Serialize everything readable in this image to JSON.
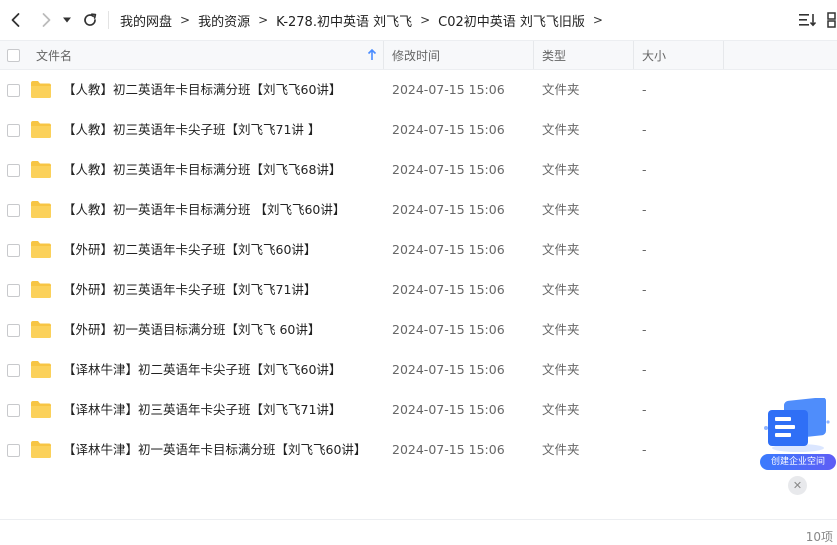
{
  "breadcrumb": [
    "我的网盘",
    "我的资源",
    "K-278.初中英语 刘飞飞",
    "C02初中英语 刘飞飞旧版"
  ],
  "breadcrumb_separator": ">",
  "table": {
    "columns": {
      "name": "文件名",
      "modified": "修改时间",
      "type": "类型",
      "size": "大小"
    },
    "rows": [
      {
        "name": "【人教】初二英语年卡目标满分班【刘飞飞60讲】",
        "modified": "2024-07-15 15:06",
        "type": "文件夹",
        "size": "-"
      },
      {
        "name": "【人教】初三英语年卡尖子班【刘飞飞71讲 】",
        "modified": "2024-07-15 15:06",
        "type": "文件夹",
        "size": "-"
      },
      {
        "name": "【人教】初三英语年卡目标满分班【刘飞飞68讲】",
        "modified": "2024-07-15 15:06",
        "type": "文件夹",
        "size": "-"
      },
      {
        "name": "【人教】初一英语年卡目标满分班 【刘飞飞60讲】",
        "modified": "2024-07-15 15:06",
        "type": "文件夹",
        "size": "-"
      },
      {
        "name": "【外研】初二英语年卡尖子班【刘飞飞60讲】",
        "modified": "2024-07-15 15:06",
        "type": "文件夹",
        "size": "-"
      },
      {
        "name": "【外研】初三英语年卡尖子班【刘飞飞71讲】",
        "modified": "2024-07-15 15:06",
        "type": "文件夹",
        "size": "-"
      },
      {
        "name": "【外研】初一英语目标满分班【刘飞飞 60讲】",
        "modified": "2024-07-15 15:06",
        "type": "文件夹",
        "size": "-"
      },
      {
        "name": "【译林牛津】初二英语年卡尖子班【刘飞飞60讲】",
        "modified": "2024-07-15 15:06",
        "type": "文件夹",
        "size": "-"
      },
      {
        "name": "【译林牛津】初三英语年卡尖子班【刘飞飞71讲】",
        "modified": "2024-07-15 15:06",
        "type": "文件夹",
        "size": "-"
      },
      {
        "name": "【译林牛津】初一英语年卡目标满分班【刘飞飞60讲】",
        "modified": "2024-07-15 15:06",
        "type": "文件夹",
        "size": "-"
      }
    ]
  },
  "footer": {
    "count": "10项"
  },
  "promo": {
    "label": "创建企业空间",
    "close": "✕"
  },
  "icons": {
    "back": "chevron-left-icon",
    "forward": "chevron-right-icon",
    "history": "caret-down-icon",
    "refresh": "refresh-icon",
    "sort": "sort-list-icon",
    "more": "grid-more-icon",
    "folder": "folder-icon",
    "sort_arrow": "arrow-up-icon"
  },
  "colors": {
    "folder": "#f7c544",
    "accent": "#3a7bfd",
    "sort_arrow": "#4a8cff"
  }
}
